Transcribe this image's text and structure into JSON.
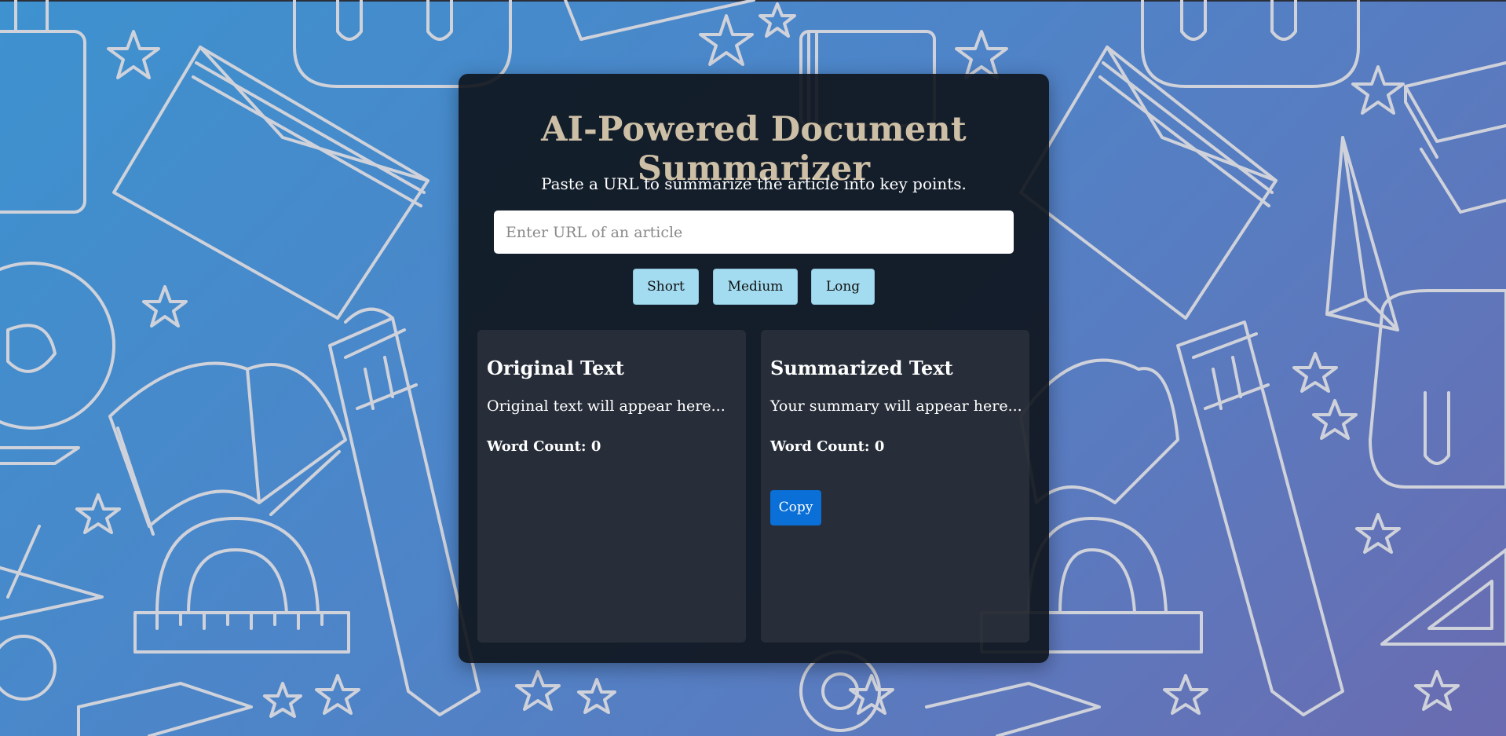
{
  "app": {
    "title": "AI-Powered Document Summarizer",
    "subtitle": "Paste a URL to summarize the article into key points."
  },
  "url_input": {
    "placeholder": "Enter URL of an article",
    "value": ""
  },
  "length_options": {
    "short_label": "Short",
    "medium_label": "Medium",
    "long_label": "Long"
  },
  "original_panel": {
    "heading": "Original Text",
    "text": "Original text will appear here...",
    "word_count_label": "Word Count: 0"
  },
  "summary_panel": {
    "heading": "Summarized Text",
    "text": "Your summary will appear here...",
    "word_count_label": "Word Count: 0",
    "copy_label": "Copy"
  },
  "colors": {
    "background_gradient_start": "#3d92cf",
    "background_gradient_end": "#6a6bb0",
    "card_background": "#0e141c",
    "title_color": "#cdbfa6",
    "length_button": "#a3dcf1",
    "copy_button": "#0a6fd6",
    "doodle_stroke": "#cfd2da"
  },
  "background_icons": [
    "school-supplies-doodle-pattern",
    "book-icon",
    "star-icon",
    "pencil-icon",
    "protractor-icon",
    "backpack-icon",
    "globe-icon",
    "scissors-icon",
    "paper-plane-icon",
    "set-square-icon",
    "tape-icon"
  ]
}
